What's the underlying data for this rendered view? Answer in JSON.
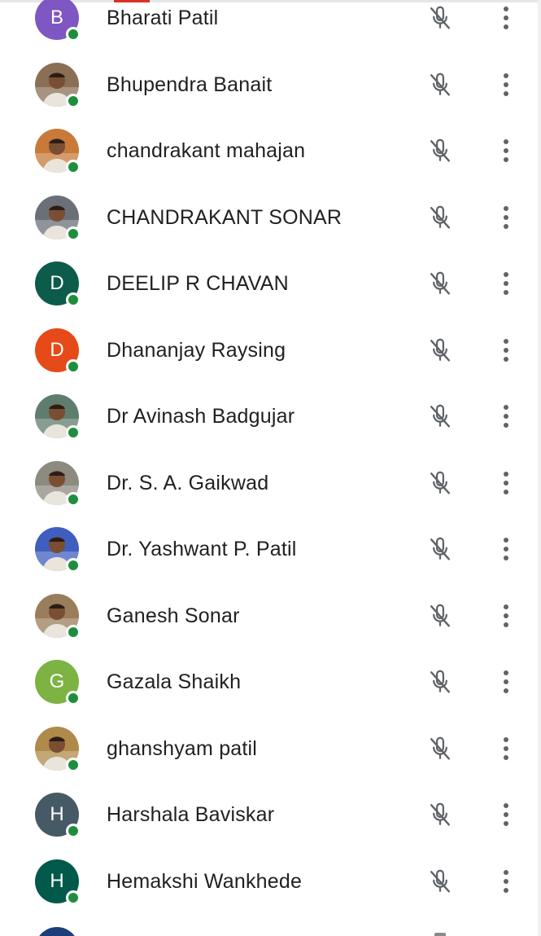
{
  "participants": [
    {
      "name": "Bharati Patil",
      "avatar_type": "initial",
      "initial": "B",
      "color": "#7e57c2",
      "muted": true,
      "online": true
    },
    {
      "name": "Bhupendra Banait",
      "avatar_type": "photo",
      "initial": "",
      "color": "#8a6f55",
      "muted": true,
      "online": true
    },
    {
      "name": "chandrakant mahajan",
      "avatar_type": "photo",
      "initial": "",
      "color": "#c77a3a",
      "muted": true,
      "online": true
    },
    {
      "name": "CHANDRAKANT SONAR",
      "avatar_type": "photo",
      "initial": "",
      "color": "#6b6f78",
      "muted": true,
      "online": true
    },
    {
      "name": "DEELIP R CHAVAN",
      "avatar_type": "initial",
      "initial": "D",
      "color": "#0d5c4b",
      "muted": true,
      "online": true
    },
    {
      "name": "Dhananjay Raysing",
      "avatar_type": "initial",
      "initial": "D",
      "color": "#e64a19",
      "muted": true,
      "online": true
    },
    {
      "name": "Dr Avinash Badgujar",
      "avatar_type": "photo",
      "initial": "",
      "color": "#5f7d6e",
      "muted": true,
      "online": true
    },
    {
      "name": "Dr. S. A. Gaikwad",
      "avatar_type": "photo",
      "initial": "",
      "color": "#8d8a80",
      "muted": true,
      "online": true
    },
    {
      "name": "Dr. Yashwant P. Patil",
      "avatar_type": "photo",
      "initial": "",
      "color": "#3f5fbf",
      "muted": true,
      "online": true
    },
    {
      "name": "Ganesh Sonar",
      "avatar_type": "photo",
      "initial": "",
      "color": "#9a7d5a",
      "muted": true,
      "online": true
    },
    {
      "name": "Gazala Shaikh",
      "avatar_type": "initial",
      "initial": "G",
      "color": "#7cb342",
      "muted": true,
      "online": true
    },
    {
      "name": "ghanshyam patil",
      "avatar_type": "photo",
      "initial": "",
      "color": "#b08a4a",
      "muted": true,
      "online": true
    },
    {
      "name": "Harshala Baviskar",
      "avatar_type": "initial",
      "initial": "H",
      "color": "#455a64",
      "muted": true,
      "online": true
    },
    {
      "name": "Hemakshi Wankhede",
      "avatar_type": "initial",
      "initial": "H",
      "color": "#00594a",
      "muted": true,
      "online": true
    }
  ],
  "icons": {
    "mic": "mic-off-icon",
    "more": "more-vert-icon",
    "status": "online-status-dot"
  },
  "colors": {
    "online": "#1e8e3e",
    "icon": "#5f6368",
    "text": "#202124"
  }
}
